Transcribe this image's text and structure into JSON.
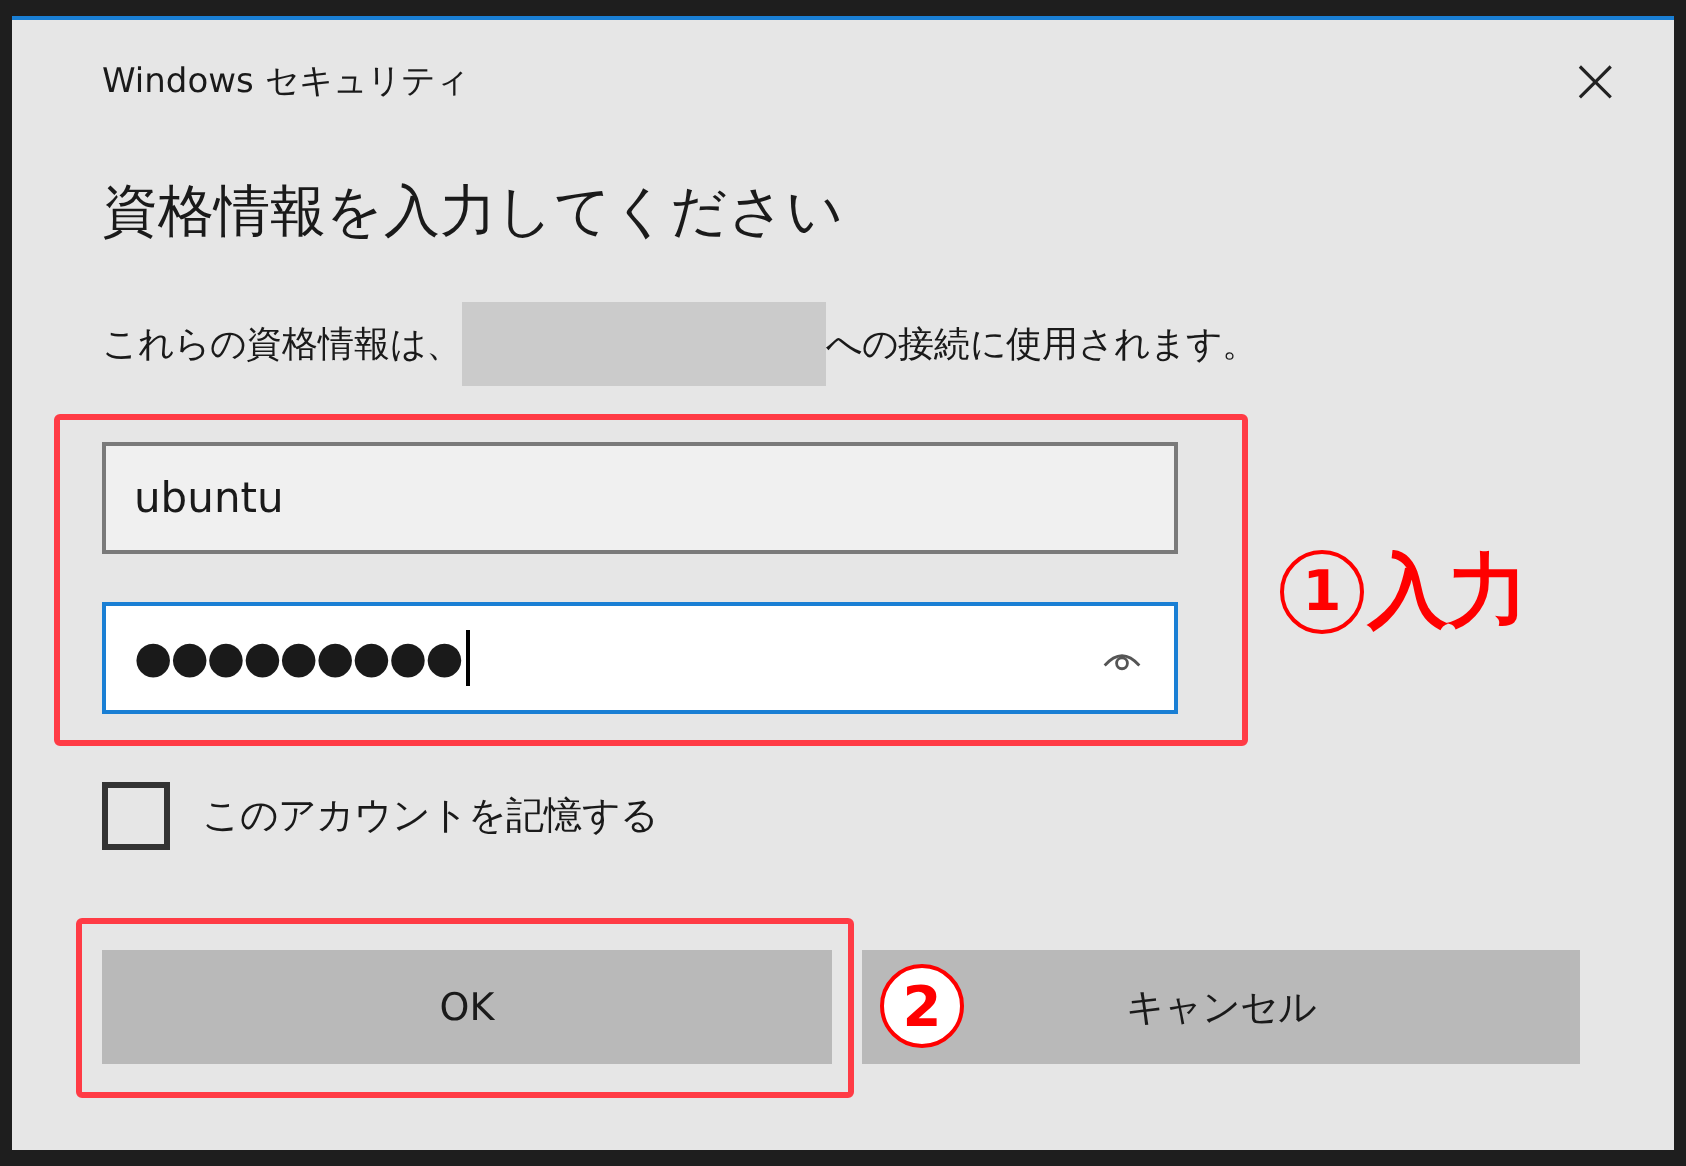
{
  "window": {
    "title": "Windows セキュリティ",
    "close": "×"
  },
  "heading": "資格情報を入力してください",
  "description": {
    "before": "これらの資格情報は、",
    "redacted": true,
    "after": "への接続に使用されます。"
  },
  "fields": [
    {
      "kind": "text",
      "value": "ubuntu",
      "focused": false
    },
    {
      "kind": "password",
      "value": "●●●●●●●●●",
      "focused": true
    }
  ],
  "remember": {
    "label": "このアカウントを記憶する",
    "checked": false
  },
  "buttons": [
    "OK",
    "キャンセル"
  ],
  "annotations": [
    {
      "number": "1",
      "label": "入力"
    },
    {
      "number": "2"
    }
  ]
}
